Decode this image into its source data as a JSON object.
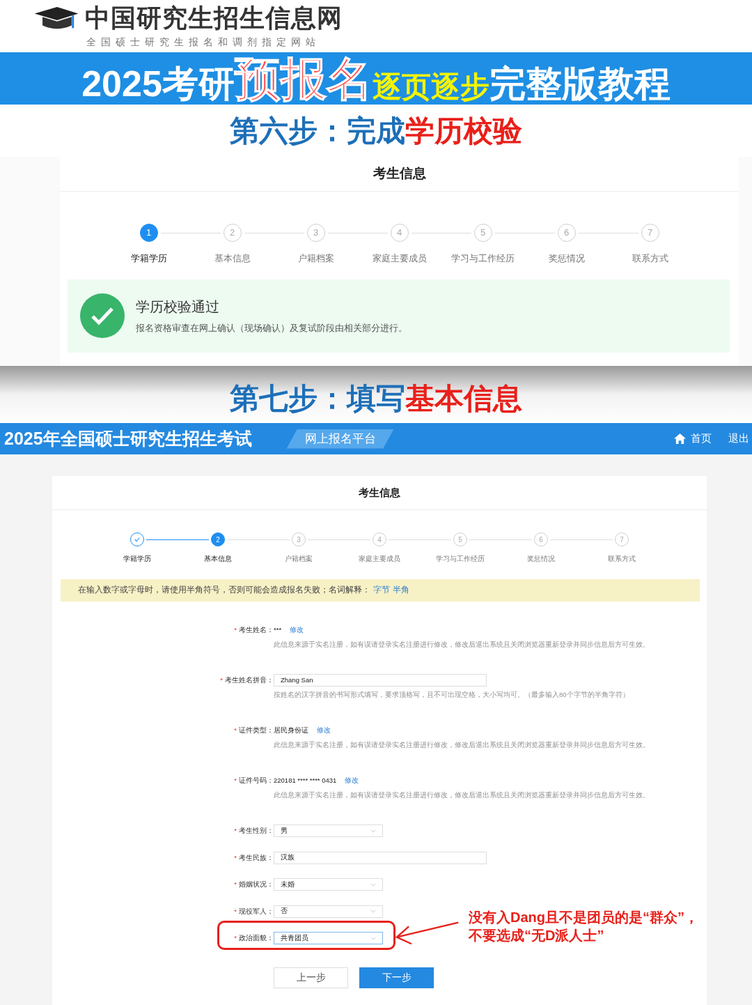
{
  "site_header": {
    "title": "中国研究生招生信息网",
    "subtitle": "全国硕士研究生报名和调剂指定网站"
  },
  "banner": {
    "segments": [
      {
        "text": "2025考研",
        "kind": "plain"
      },
      {
        "text": "预报名",
        "kind": "big"
      },
      {
        "text": "逐页逐步",
        "kind": "yellow"
      },
      {
        "text": "完整版教程",
        "kind": "plain"
      }
    ]
  },
  "step_six": {
    "heading": [
      {
        "text": "第六步：完成",
        "kind": "plain"
      },
      {
        "text": "学历校验",
        "kind": "red"
      }
    ],
    "card_title": "考生信息",
    "steps": [
      {
        "number": "1",
        "label": "学籍学历",
        "selected": true,
        "completed": false
      },
      {
        "number": "2",
        "label": "基本信息",
        "selected": false,
        "completed": false
      },
      {
        "number": "3",
        "label": "户籍档案",
        "selected": false,
        "completed": false
      },
      {
        "number": "4",
        "label": "家庭主要成员",
        "selected": false,
        "completed": false
      },
      {
        "number": "5",
        "label": "学习与工作经历",
        "selected": false,
        "completed": false
      },
      {
        "number": "6",
        "label": "奖惩情况",
        "selected": false,
        "completed": false
      },
      {
        "number": "7",
        "label": "联系方式",
        "selected": false,
        "completed": false
      }
    ],
    "result": {
      "title": "学历校验通过",
      "message": "报名资格审查在网上确认（现场确认）及复试阶段由相关部分进行。"
    }
  },
  "step_seven": {
    "heading": [
      {
        "text": "第七步：",
        "kind": "plain"
      },
      {
        "text": "填写",
        "kind": "plain"
      },
      {
        "text": "基本信息",
        "kind": "red"
      }
    ],
    "top_bar": {
      "title": "2025年全国硕士研究生招生考试",
      "platform": "网上报名平台",
      "home": "首页",
      "logout": "退出"
    },
    "card_title": "考生信息",
    "steps": [
      {
        "label": "学籍学历",
        "selected": false,
        "completed": true
      },
      {
        "number": "2",
        "label": "基本信息",
        "selected": true,
        "completed": false
      },
      {
        "number": "3",
        "label": "户籍档案",
        "selected": false,
        "completed": false
      },
      {
        "number": "4",
        "label": "家庭主要成员",
        "selected": false,
        "completed": false
      },
      {
        "number": "5",
        "label": "学习与工作经历",
        "selected": false,
        "completed": false
      },
      {
        "number": "6",
        "label": "奖惩情况",
        "selected": false,
        "completed": false
      },
      {
        "number": "7",
        "label": "联系方式",
        "selected": false,
        "completed": false
      }
    ],
    "notice": {
      "text": "在输入数字或字母时，请使用半角符号，否则可能会造成报名失败；名词解释：",
      "links": [
        "字节",
        "半角"
      ]
    },
    "fields": [
      {
        "kind": "readonly",
        "required_mark": "*",
        "label": "考生姓名：",
        "value": "***",
        "link": "修改",
        "hint": "此信息来源于实名注册，如有误请登录实名注册进行修改，修改后退出系统且关闭浏览器重新登录并同步信息后方可生效。",
        "highlighted": false
      },
      {
        "kind": "input",
        "required_mark": "*",
        "label": "考生姓名拼音：",
        "value": "Zhang San",
        "hint": "按姓名的汉字拼音的书写形式填写，要求顶格写，且不可出现空格，大小写均可。（最多输入80个字节的半角字符）",
        "highlighted": false
      },
      {
        "kind": "readonly",
        "required_mark": "*",
        "label": "证件类型：",
        "value": "居民身份证",
        "link": "修改",
        "hint": "此信息来源于实名注册，如有误请登录实名注册进行修改，修改后退出系统且关闭浏览器重新登录并同步信息后方可生效。",
        "highlighted": false
      },
      {
        "kind": "readonly",
        "required_mark": "*",
        "label": "证件号码：",
        "value": "220181 **** **** 0431",
        "link": "修改",
        "hint": "此信息来源于实名注册，如有误请登录实名注册进行修改，修改后退出系统且关闭浏览器重新登录并同步信息后方可生效。",
        "highlighted": false
      },
      {
        "kind": "select",
        "required_mark": "*",
        "label": "考生性别：",
        "value": "男",
        "highlighted": false
      },
      {
        "kind": "input",
        "required_mark": "*",
        "label": "考生民族：",
        "value": "汉族",
        "highlighted": false
      },
      {
        "kind": "select",
        "required_mark": "*",
        "label": "婚姻状况：",
        "value": "未婚",
        "highlighted": false
      },
      {
        "kind": "select",
        "required_mark": "*",
        "label": "现役军人：",
        "value": "否",
        "highlighted": false
      },
      {
        "kind": "select",
        "required_mark": "*",
        "label": "政治面貌：",
        "value": "共青团员",
        "highlighted": true
      }
    ],
    "buttons": {
      "previous": "上一步",
      "next": "下一步"
    },
    "annotation": [
      "没有入Dang且不是团员的是“群众”，",
      "不要选成“无D派人士”"
    ]
  }
}
